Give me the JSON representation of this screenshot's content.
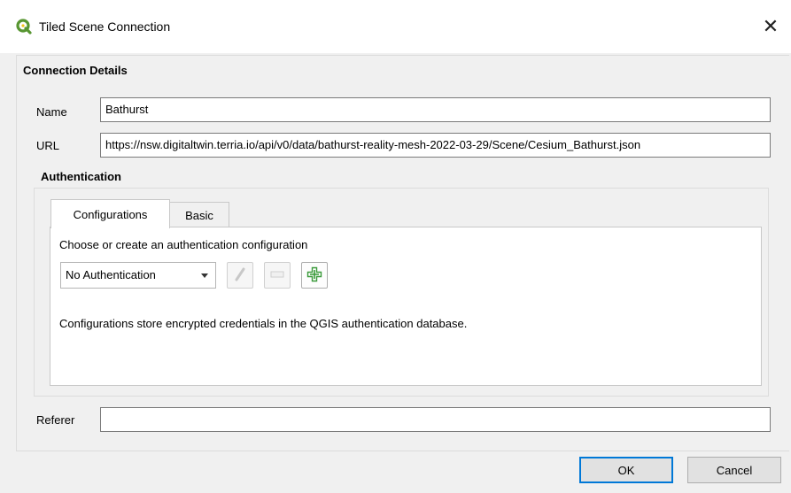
{
  "window": {
    "title": "Tiled Scene Connection",
    "close_glyph": "✕"
  },
  "connection_details": {
    "heading": "Connection Details",
    "name_label": "Name",
    "name_value": "Bathurst",
    "url_label": "URL",
    "url_value": "https://nsw.digitaltwin.terria.io/api/v0/data/bathurst-reality-mesh-2022-03-29/Scene/Cesium_Bathurst.json"
  },
  "authentication": {
    "heading": "Authentication",
    "tabs": [
      {
        "label": "Configurations",
        "active": true
      },
      {
        "label": "Basic",
        "active": false
      }
    ],
    "instruction": "Choose or create an authentication configuration",
    "config_select": {
      "selected": "No Authentication"
    },
    "buttons": {
      "edit": {
        "icon": "pencil-icon",
        "enabled": false
      },
      "remove": {
        "icon": "minus-icon",
        "enabled": false
      },
      "add": {
        "icon": "plus-icon",
        "enabled": true
      }
    },
    "info": "Configurations store encrypted credentials in the QGIS authentication database."
  },
  "referer": {
    "label": "Referer",
    "value": ""
  },
  "footer": {
    "ok_label": "OK",
    "cancel_label": "Cancel"
  },
  "colors": {
    "qgis_green": "#589632",
    "default_button_border": "#0078d7",
    "add_icon_green": "#3a9a3a"
  }
}
